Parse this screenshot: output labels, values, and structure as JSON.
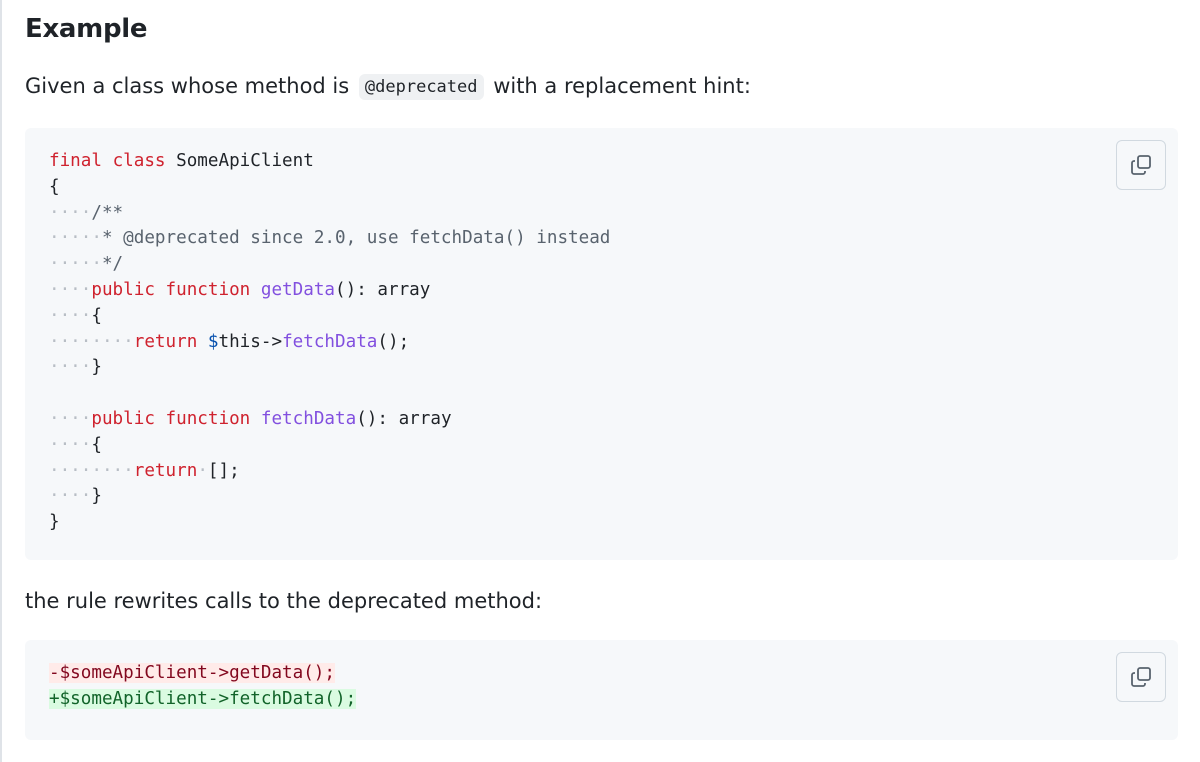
{
  "heading": "Example",
  "intro": {
    "before": "Given a class whose method is",
    "code": "@deprecated",
    "after": "with a replacement hint:"
  },
  "class_block": {
    "copy_icon": "copy-icon",
    "lines": [
      [
        {
          "t": "final",
          "c": "kw"
        },
        {
          "t": " ",
          "c": ""
        },
        {
          "t": "class",
          "c": "kw"
        },
        {
          "t": " SomeApiClient",
          "c": ""
        }
      ],
      [
        {
          "t": "{",
          "c": ""
        }
      ],
      [
        {
          "t": "····",
          "c": "ws"
        },
        {
          "t": "/**",
          "c": "cm"
        }
      ],
      [
        {
          "t": "·····",
          "c": "ws"
        },
        {
          "t": "* @deprecated since 2.0, use fetchData() instead",
          "c": "cm"
        }
      ],
      [
        {
          "t": "·····",
          "c": "ws"
        },
        {
          "t": "*/",
          "c": "cm"
        }
      ],
      [
        {
          "t": "····",
          "c": "ws"
        },
        {
          "t": "public",
          "c": "kw"
        },
        {
          "t": " ",
          "c": ""
        },
        {
          "t": "function",
          "c": "kw"
        },
        {
          "t": " ",
          "c": ""
        },
        {
          "t": "getData",
          "c": "fn"
        },
        {
          "t": "(): array",
          "c": ""
        }
      ],
      [
        {
          "t": "····",
          "c": "ws"
        },
        {
          "t": "{",
          "c": ""
        }
      ],
      [
        {
          "t": "········",
          "c": "ws"
        },
        {
          "t": "return",
          "c": "kw"
        },
        {
          "t": " ",
          "c": ""
        },
        {
          "t": "$",
          "c": "var"
        },
        {
          "t": "this->",
          "c": ""
        },
        {
          "t": "fetchData",
          "c": "fn"
        },
        {
          "t": "();",
          "c": ""
        }
      ],
      [
        {
          "t": "····",
          "c": "ws"
        },
        {
          "t": "}",
          "c": ""
        }
      ],
      [
        {
          "t": "",
          "c": ""
        }
      ],
      [
        {
          "t": "····",
          "c": "ws"
        },
        {
          "t": "public",
          "c": "kw"
        },
        {
          "t": " ",
          "c": ""
        },
        {
          "t": "function",
          "c": "kw"
        },
        {
          "t": " ",
          "c": ""
        },
        {
          "t": "fetchData",
          "c": "fn"
        },
        {
          "t": "(): array",
          "c": ""
        }
      ],
      [
        {
          "t": "····",
          "c": "ws"
        },
        {
          "t": "{",
          "c": ""
        }
      ],
      [
        {
          "t": "········",
          "c": "ws"
        },
        {
          "t": "return",
          "c": "kw"
        },
        {
          "t": "·",
          "c": "ws"
        },
        {
          "t": "[];",
          "c": ""
        }
      ],
      [
        {
          "t": "····",
          "c": "ws"
        },
        {
          "t": "}",
          "c": ""
        }
      ],
      [
        {
          "t": "}",
          "c": ""
        }
      ]
    ]
  },
  "outro": "the rule rewrites calls to the deprecated method:",
  "diff_block": {
    "copy_icon": "copy-icon",
    "lines": [
      [
        {
          "t": "-$someApiClient->getData();",
          "c": "diff-del"
        }
      ],
      [
        {
          "t": "+$someApiClient->fetchData();",
          "c": "diff-add"
        }
      ]
    ]
  },
  "colors": {
    "keyword": "#cf222e",
    "function": "#8250df",
    "variable": "#0550ae",
    "comment": "#59636e",
    "whitespace_marker": "#b8bec5",
    "code_background": "#f6f8fa",
    "diff_removed_bg": "#ffebe9",
    "diff_added_bg": "#dafbe1"
  }
}
